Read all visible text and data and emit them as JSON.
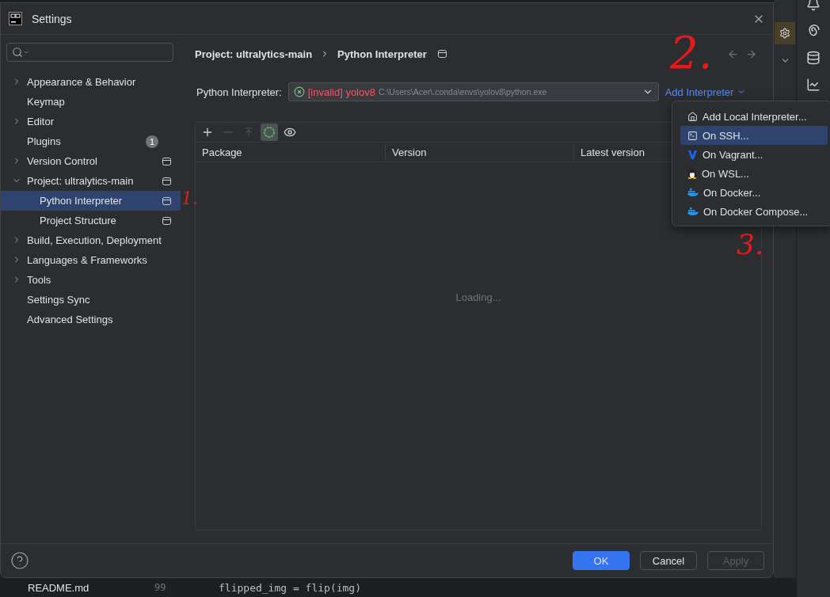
{
  "window": {
    "title": "Settings"
  },
  "sidebar": {
    "items": [
      {
        "label": "Appearance & Behavior",
        "kind": "group",
        "expanded": false,
        "selected": false,
        "scoped": false
      },
      {
        "label": "Keymap",
        "kind": "page",
        "selected": false,
        "scoped": false
      },
      {
        "label": "Editor",
        "kind": "group",
        "expanded": false,
        "selected": false,
        "scoped": false
      },
      {
        "label": "Plugins",
        "kind": "page",
        "selected": false,
        "scoped": false,
        "badge": "1"
      },
      {
        "label": "Version Control",
        "kind": "group",
        "expanded": false,
        "selected": false,
        "scoped": true
      },
      {
        "label": "Project: ultralytics-main",
        "kind": "group",
        "expanded": true,
        "selected": false,
        "scoped": true,
        "children": [
          {
            "label": "Python Interpreter",
            "kind": "page",
            "selected": true,
            "scoped": true
          },
          {
            "label": "Project Structure",
            "kind": "page",
            "selected": false,
            "scoped": true
          }
        ]
      },
      {
        "label": "Build, Execution, Deployment",
        "kind": "group",
        "expanded": false,
        "selected": false,
        "scoped": false
      },
      {
        "label": "Languages & Frameworks",
        "kind": "group",
        "expanded": false,
        "selected": false,
        "scoped": false
      },
      {
        "label": "Tools",
        "kind": "group",
        "expanded": false,
        "selected": false,
        "scoped": false
      },
      {
        "label": "Settings Sync",
        "kind": "page",
        "selected": false,
        "scoped": false
      },
      {
        "label": "Advanced Settings",
        "kind": "page",
        "selected": false,
        "scoped": false
      }
    ]
  },
  "breadcrumb": {
    "items": [
      "Project: ultralytics-main",
      "Python Interpreter"
    ],
    "scoped": true
  },
  "interpreter": {
    "label": "Python Interpreter:",
    "invalid": true,
    "status": "[invalid]",
    "name": "yolov8",
    "path": "C:\\Users\\Acer\\.conda\\envs\\yolov8\\python.exe"
  },
  "add_interpreter": {
    "label": "Add Interpreter"
  },
  "toolbar": [
    {
      "kind": "add",
      "disabled": false,
      "active": false
    },
    {
      "kind": "remove",
      "disabled": true,
      "active": false
    },
    {
      "kind": "upgrade",
      "disabled": true,
      "active": false
    },
    {
      "kind": "refresh",
      "disabled": false,
      "active": true
    },
    {
      "kind": "show",
      "disabled": false,
      "active": false
    }
  ],
  "table": {
    "columns": [
      "Package",
      "Version",
      "Latest version"
    ],
    "status": "Loading..."
  },
  "menu": {
    "items": [
      {
        "kind": "local",
        "label": "Add Local Interpreter...",
        "selected": false
      },
      {
        "kind": "ssh",
        "label": "On SSH...",
        "selected": true
      },
      {
        "kind": "vagrant",
        "label": "On Vagrant...",
        "selected": false
      },
      {
        "kind": "wsl",
        "label": "On WSL...",
        "selected": false
      },
      {
        "kind": "docker",
        "label": "On Docker...",
        "selected": false
      },
      {
        "kind": "docker",
        "label": "On Docker Compose...",
        "selected": false
      }
    ]
  },
  "buttons": [
    {
      "label": "OK",
      "kind": "primary",
      "disabled": false
    },
    {
      "label": "Cancel",
      "kind": "default",
      "disabled": false
    },
    {
      "label": "Apply",
      "kind": "default",
      "disabled": true
    }
  ],
  "annotations": [
    "1.",
    "2.",
    "3."
  ],
  "ide": {
    "file_tab": "README.md",
    "line_number": "99",
    "code": "flipped_img = flip(img)"
  }
}
